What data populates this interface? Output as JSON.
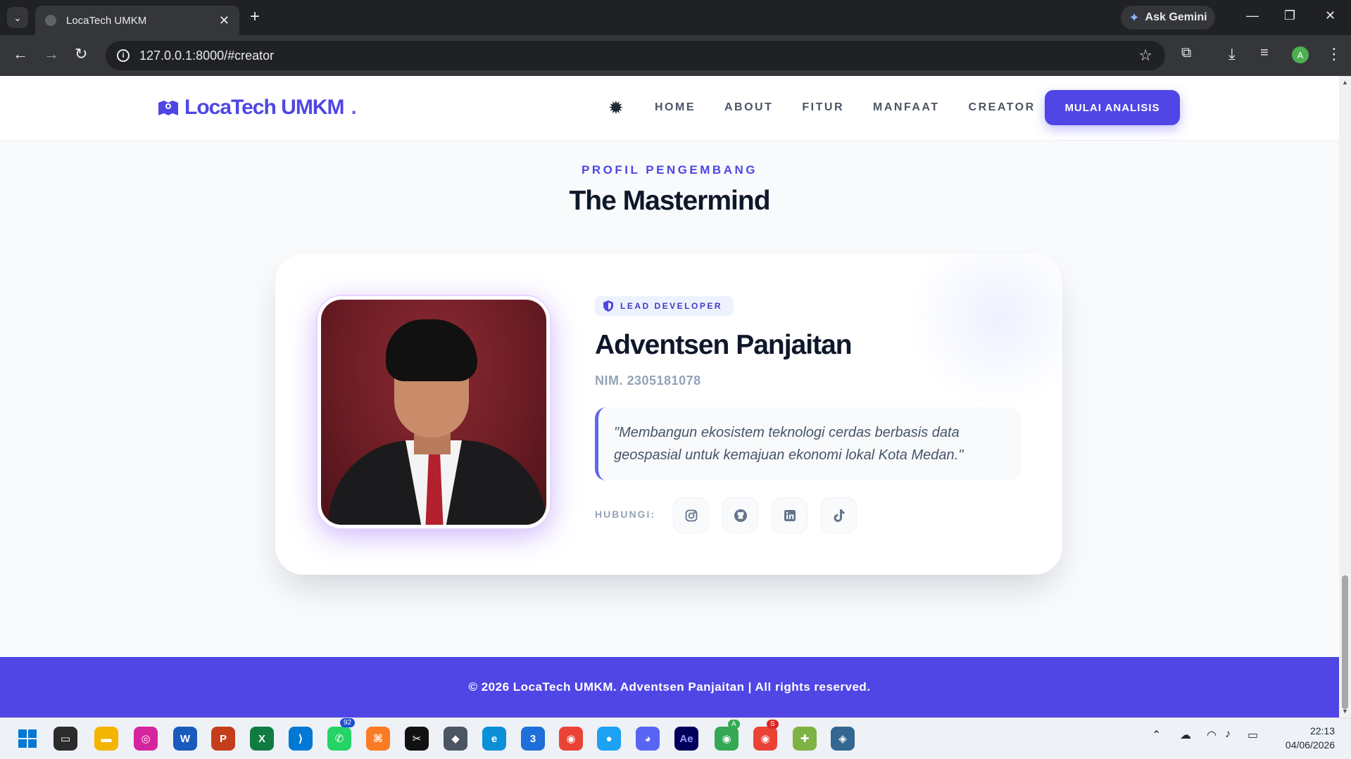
{
  "browser": {
    "tab_title": "LocaTech UMKM",
    "url": "127.0.0.1:8000/#creator",
    "gemini_label": "Ask Gemini",
    "profile_initial": "A"
  },
  "navbar": {
    "logo_text": "LocaTech UMKM",
    "logo_dot": ".",
    "items": [
      {
        "label": "HOME"
      },
      {
        "label": "ABOUT"
      },
      {
        "label": "FITUR"
      },
      {
        "label": "MANFAAT"
      },
      {
        "label": "CREATOR"
      }
    ],
    "cta_label": "MULAI ANALISIS"
  },
  "section": {
    "eyebrow": "PROFIL PENGEMBANG",
    "title": "The Mastermind"
  },
  "profile": {
    "role": "LEAD DEVELOPER",
    "name": "Adventsen Panjaitan",
    "nim": "NIM. 2305181078",
    "quote": "\"Membangun ekosistem teknologi cerdas berbasis data geospasial untuk kemajuan ekonomi lokal Kota Medan.\"",
    "contact_label": "HUBUNGI:",
    "socials": [
      {
        "icon": "instagram-icon"
      },
      {
        "icon": "github-icon"
      },
      {
        "icon": "linkedin-icon"
      },
      {
        "icon": "tiktok-icon"
      }
    ]
  },
  "footer": {
    "text": "© 2026 LocaTech UMKM. Adventsen Panjaitan | All rights reserved."
  },
  "taskbar": {
    "whatsapp_badge": "92",
    "chrome_badge": "A",
    "chrome2_badge": "S",
    "time": "22:13",
    "date": "04/06/2026"
  },
  "colors": {
    "accent": "#4f46e5",
    "heading": "#0f172a",
    "muted": "#94a3b8"
  }
}
